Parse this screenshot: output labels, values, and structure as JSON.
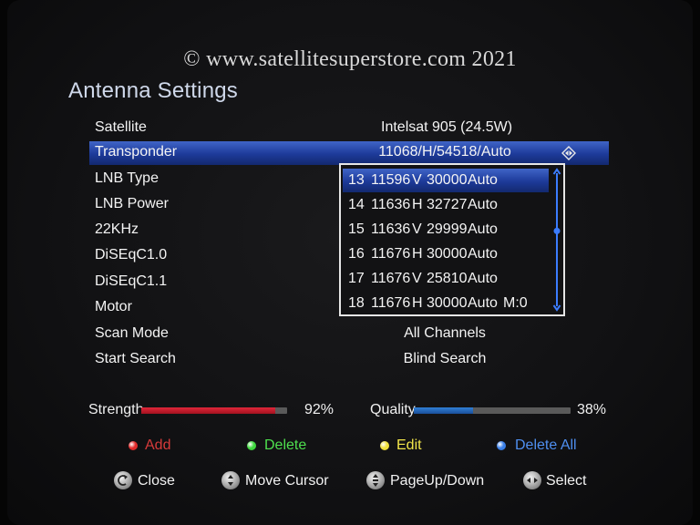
{
  "watermark": "© www.satellitesuperstore.com 2021",
  "title": "Antenna Settings",
  "menu": [
    {
      "label": "Satellite",
      "value": "Intelsat 905  (24.5W)"
    },
    {
      "label": "Transponder",
      "value": "11068/H/54518/Auto"
    },
    {
      "label": "LNB Type",
      "value": ""
    },
    {
      "label": "LNB Power",
      "value": ""
    },
    {
      "label": "22KHz",
      "value": ""
    },
    {
      "label": "DiSEqC1.0",
      "value": ""
    },
    {
      "label": "DiSEqC1.1",
      "value": ""
    },
    {
      "label": "Motor",
      "value": ""
    },
    {
      "label": "Scan Mode",
      "value": "All Channels"
    },
    {
      "label": "Start Search",
      "value": "Blind Search"
    }
  ],
  "selected_menu": "Transponder",
  "transponder_list": [
    {
      "num": "13",
      "freq": "11596",
      "pol": "V",
      "sr": "30000",
      "fec": "Auto",
      "extra": ""
    },
    {
      "num": "14",
      "freq": "11636",
      "pol": "H",
      "sr": "32727",
      "fec": "Auto",
      "extra": ""
    },
    {
      "num": "15",
      "freq": "11636",
      "pol": "V",
      "sr": "29999",
      "fec": "Auto",
      "extra": ""
    },
    {
      "num": "16",
      "freq": "11676",
      "pol": "H",
      "sr": "30000",
      "fec": "Auto",
      "extra": ""
    },
    {
      "num": "17",
      "freq": "11676",
      "pol": "V",
      "sr": "25810",
      "fec": "Auto",
      "extra": ""
    },
    {
      "num": "18",
      "freq": "11676",
      "pol": "H",
      "sr": "30000",
      "fec": "Auto",
      "extra": "M:0"
    }
  ],
  "active_transponder": "13",
  "scroll_position": 0.43,
  "strength": {
    "label": "Strength",
    "percent": 92,
    "display": "92%",
    "color": "#e0263a"
  },
  "quality": {
    "label": "Quality",
    "percent": 38,
    "display": "38%",
    "color": "#2f7fd6"
  },
  "color_keys": [
    {
      "label": "Add",
      "color": "#e02a2a",
      "text_color": "#d63a3a"
    },
    {
      "label": "Delete",
      "color": "#3fd83f",
      "text_color": "#4ee04e"
    },
    {
      "label": "Edit",
      "color": "#f0e23a",
      "text_color": "#f2e64a"
    },
    {
      "label": "Delete All",
      "color": "#3a7fe8",
      "text_color": "#4f8ff0"
    }
  ],
  "nav_keys": [
    {
      "label": "Close",
      "icon": "exit-icon"
    },
    {
      "label": "Move Cursor",
      "icon": "up-down-icon"
    },
    {
      "label": "PageUp/Down",
      "icon": "page-up-down-icon"
    },
    {
      "label": "Select",
      "icon": "left-right-icon"
    }
  ]
}
